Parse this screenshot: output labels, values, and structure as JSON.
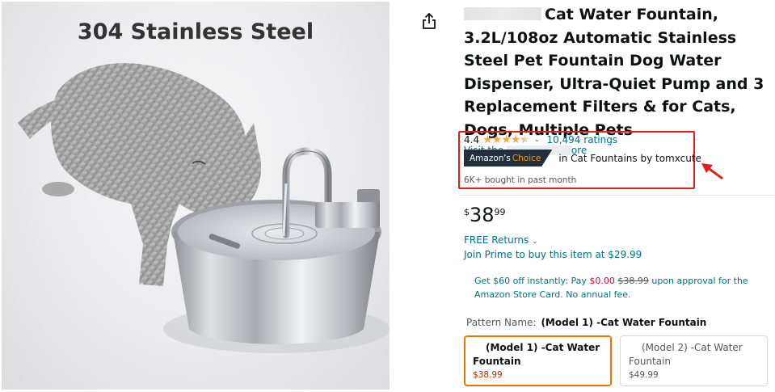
{
  "product_image": {
    "caption": "304 Stainless Steel"
  },
  "share": {
    "icon": "share-icon"
  },
  "title": {
    "brand_hidden": "",
    "text": "Cat Water Fountain, 3.2L/108oz Automatic Stainless Steel Pet Fountain Dog Water Dispenser, Ultra-Quiet Pump and 3 Replacement Filters & for Cats, Dogs, Multiple Pets"
  },
  "store_link": {
    "prefix": "Visit the",
    "suffix": "ore"
  },
  "rating": {
    "value": "4.4",
    "stars": 4.4,
    "count_label": "10,494 ratings"
  },
  "badge": {
    "prefix": "Amazon's",
    "highlight": "Choice",
    "category_text": "in Cat Fountains by tomxcute"
  },
  "bought": "6K+ bought in past month",
  "price": {
    "symbol": "$",
    "whole": "38",
    "fraction": "99"
  },
  "returns": "FREE Returns",
  "prime": "Join Prime to buy this item at $29.99",
  "promo": {
    "line_start": "Get $60 off instantly: Pay ",
    "pay_amount": "$0.00",
    "list_price": "$38.99",
    "line_end": " upon approval for the Amazon Store Card. No annual fee."
  },
  "pattern": {
    "label": "Pattern Name:",
    "value": "(Model 1) -Cat Water Fountain"
  },
  "options": [
    {
      "line1": "(Model 1) -Cat Water",
      "line2": "Fountain",
      "price": "$38.99",
      "selected": true
    },
    {
      "line1": "(Model 2) -Cat Water",
      "line2": "Fountain",
      "price": "$49.99",
      "selected": false
    }
  ],
  "colors": {
    "link": "#007185",
    "highlight_box": "#e01e1e",
    "star": "#f3a847",
    "badge_bg": "#232f3e",
    "badge_orange": "#ff9900",
    "price_red": "#b12704",
    "selected_border": "#e77600"
  }
}
